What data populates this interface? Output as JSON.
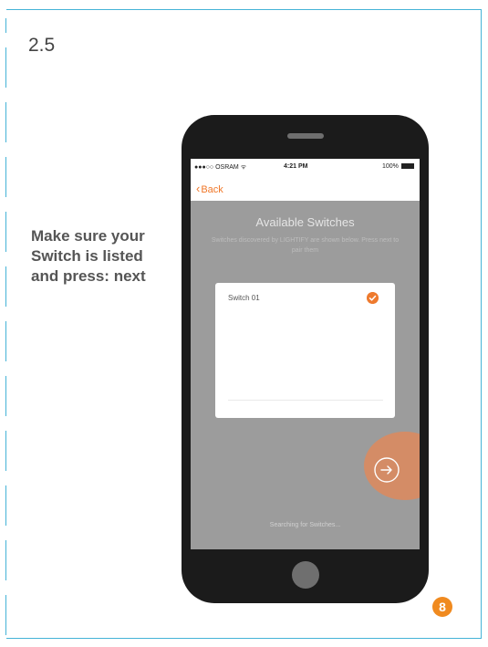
{
  "step_number": "2.5",
  "instruction": "Make sure your Switch is listed and press: next",
  "phone": {
    "status": {
      "carrier": "●●●○○ OSRAM ᯤ",
      "time": "4:21 PM",
      "battery": "100%"
    },
    "back_label": "Back",
    "title": "Available Switches",
    "description": "Switches discovered by LIGHTIFY are shown below. Press next to pair them",
    "switches": [
      {
        "name": "Switch 01",
        "selected": true
      }
    ],
    "searching_text": "Searching for Switches..."
  },
  "page_number": "8",
  "colors": {
    "accent": "#f0782a",
    "frame": "#45b3d7",
    "badge": "#f08a1f"
  },
  "icons": {
    "back": "chevron-left-icon",
    "selected": "checkmark-icon",
    "next": "arrow-right-circle-icon"
  }
}
